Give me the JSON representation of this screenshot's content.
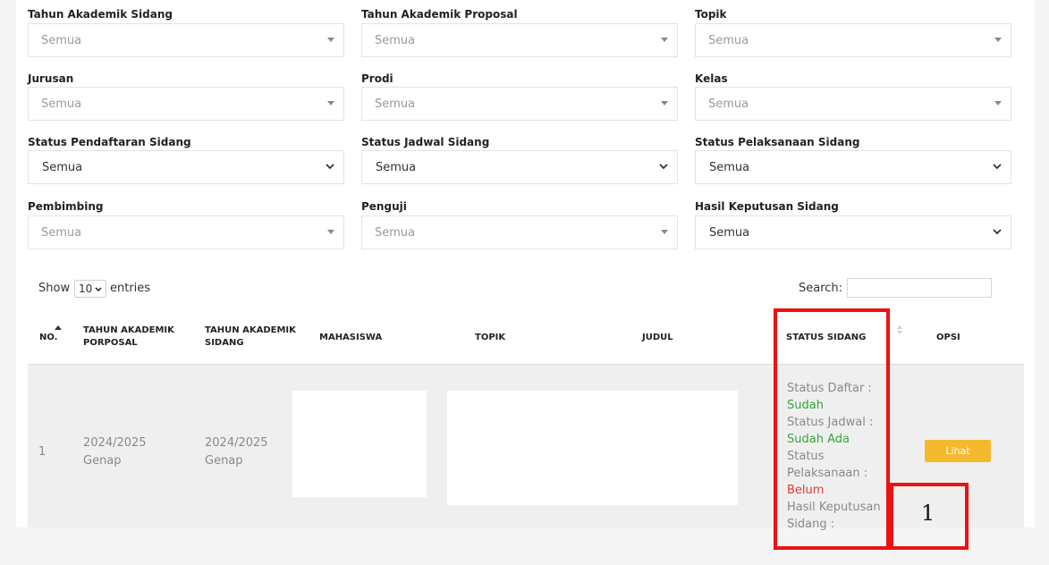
{
  "filters": {
    "tahun_sidang": {
      "label": "Tahun Akademik Sidang",
      "value": "Semua"
    },
    "tahun_proposal": {
      "label": "Tahun Akademik Proposal",
      "value": "Semua"
    },
    "topik": {
      "label": "Topik",
      "value": "Semua"
    },
    "jurusan": {
      "label": "Jurusan",
      "value": "Semua"
    },
    "prodi": {
      "label": "Prodi",
      "value": "Semua"
    },
    "kelas": {
      "label": "Kelas",
      "value": "Semua"
    },
    "status_pendaftaran": {
      "label": "Status Pendaftaran Sidang",
      "value": "Semua"
    },
    "status_jadwal": {
      "label": "Status Jadwal Sidang",
      "value": "Semua"
    },
    "status_pelaksanaan": {
      "label": "Status Pelaksanaan Sidang",
      "value": "Semua"
    },
    "pembimbing": {
      "label": "Pembimbing",
      "value": "Semua"
    },
    "penguji": {
      "label": "Penguji",
      "value": "Semua"
    },
    "hasil_keputusan": {
      "label": "Hasil Keputusan Sidang",
      "value": "Semua"
    }
  },
  "table_controls": {
    "show_label": "Show",
    "entries_value": "10",
    "entries_label": "entries",
    "search_label": "Search:"
  },
  "columns": {
    "no": "NO.",
    "tahun_proposal_l1": "TAHUN AKADEMIK",
    "tahun_proposal_l2": "PORPOSAL",
    "tahun_sidang_l1": "TAHUN AKADEMIK",
    "tahun_sidang_l2": "SIDANG",
    "mahasiswa": "MAHASISWA",
    "topik": "TOPIK",
    "judul": "JUDUL",
    "status_sidang": "STATUS SIDANG",
    "opsi": "OPSI"
  },
  "rows": [
    {
      "no": "1",
      "tahun_proposal_l1": "2024/2025",
      "tahun_proposal_l2": "Genap",
      "tahun_sidang_l1": "2024/2025",
      "tahun_sidang_l2": "Genap",
      "status_daftar_label": "Status Daftar :",
      "status_daftar_value": "Sudah",
      "status_jadwal_label": "Status Jadwal :",
      "status_jadwal_value": "Sudah Ada",
      "status_pelaksanaan_l1": "Status",
      "status_pelaksanaan_l2": "Pelaksanaan :",
      "status_pelaksanaan_value": "Belum",
      "hasil_l1": "Hasil Keputusan",
      "hasil_l2": "Sidang :",
      "action_label": "Lihat"
    }
  ],
  "annotation": {
    "label": "1"
  },
  "colors": {
    "accent_button": "#f5b92e",
    "highlight_box": "#ee1111",
    "status_ok": "#3aa53a",
    "status_no": "#e53935"
  }
}
